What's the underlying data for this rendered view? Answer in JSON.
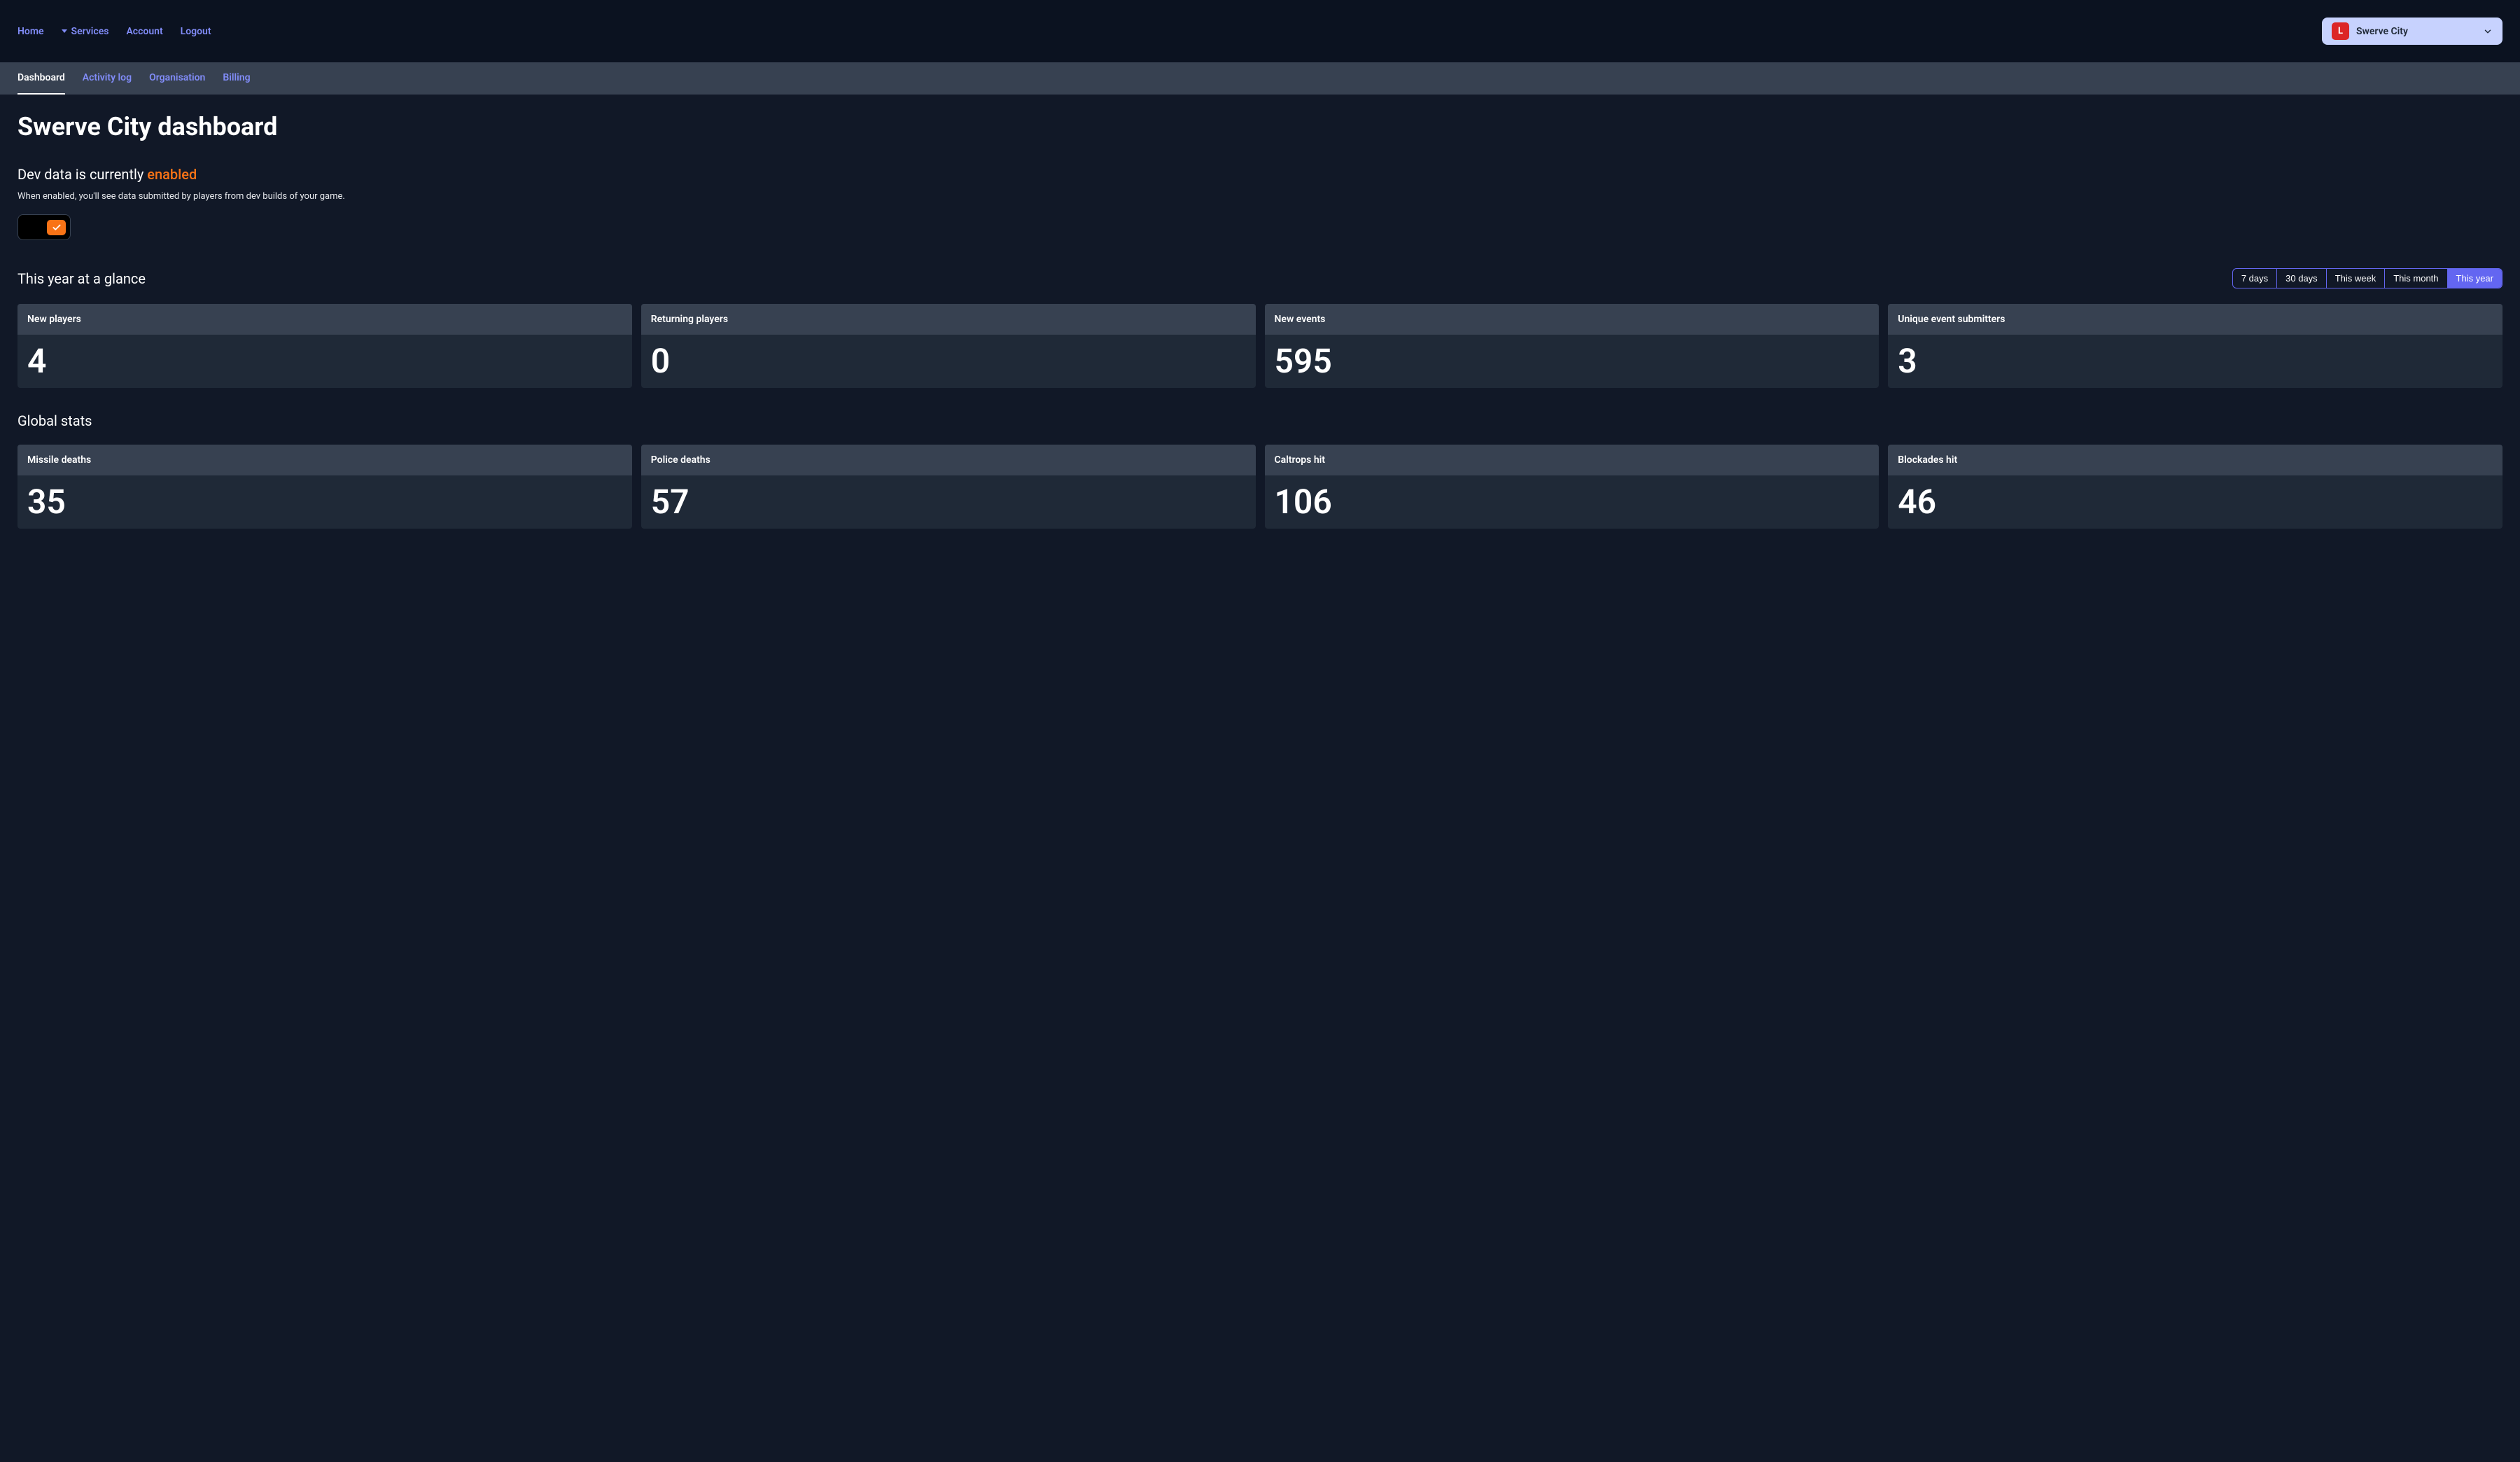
{
  "nav": {
    "home": "Home",
    "services": "Services",
    "account": "Account",
    "logout": "Logout"
  },
  "gameSelector": {
    "badge": "L",
    "name": "Swerve City"
  },
  "tabs": {
    "dashboard": "Dashboard",
    "activity": "Activity log",
    "organisation": "Organisation",
    "billing": "Billing"
  },
  "page": {
    "title": "Swerve City dashboard"
  },
  "devData": {
    "prefix": "Dev data is currently ",
    "status": "enabled",
    "description": "When enabled, you'll see data submitted by players from dev builds of your game."
  },
  "glance": {
    "title": "This year at a glance"
  },
  "timeRanges": {
    "r1": "7 days",
    "r2": "30 days",
    "r3": "This week",
    "r4": "This month",
    "r5": "This year"
  },
  "glanceStats": [
    {
      "label": "New players",
      "value": "4"
    },
    {
      "label": "Returning players",
      "value": "0"
    },
    {
      "label": "New events",
      "value": "595"
    },
    {
      "label": "Unique event submitters",
      "value": "3"
    }
  ],
  "globalTitle": "Global stats",
  "globalStats": [
    {
      "label": "Missile deaths",
      "value": "35"
    },
    {
      "label": "Police deaths",
      "value": "57"
    },
    {
      "label": "Caltrops hit",
      "value": "106"
    },
    {
      "label": "Blockades hit",
      "value": "46"
    }
  ]
}
